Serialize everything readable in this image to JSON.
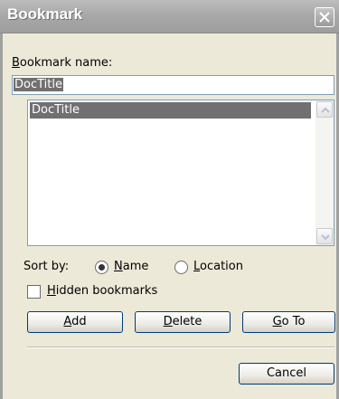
{
  "window": {
    "title": "Bookmark"
  },
  "name_field": {
    "label_accel": "B",
    "label_rest": "ookmark name:",
    "value": "DocTitle"
  },
  "bookmarks": {
    "items": [
      "DocTitle"
    ]
  },
  "sort": {
    "label": "Sort by:",
    "options": [
      {
        "accel": "N",
        "rest": "ame",
        "selected": true
      },
      {
        "accel": "L",
        "rest": "ocation",
        "selected": false
      }
    ]
  },
  "hidden": {
    "accel": "H",
    "rest": "idden bookmarks",
    "checked": false
  },
  "buttons": {
    "add": {
      "accel": "A",
      "rest": "dd"
    },
    "delete": {
      "accel": "D",
      "rest": "elete"
    },
    "goto": {
      "accel": "G",
      "rest": "o To"
    },
    "cancel": "Cancel"
  },
  "icons": {
    "close": "close-x-icon",
    "scroll_up": "scroll-up-arrow-icon",
    "scroll_down": "scroll-down-arrow-icon",
    "radio": "radio-button-icon",
    "checkbox": "checkbox-icon"
  }
}
